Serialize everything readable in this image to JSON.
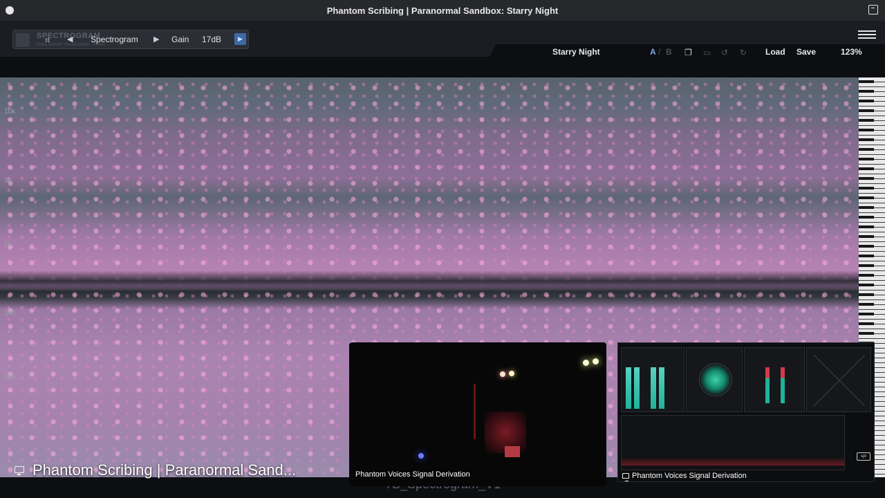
{
  "window": {
    "title": "Phantom Scribing | Paranormal Sandbox: Starry Night"
  },
  "plugin_toolbar": {
    "ghost_title": "SPECTROGRAM",
    "ghost_subtitle": "Data Based Visualization Toolkit",
    "view_name": "Spectrogram",
    "gain_label": "Gain",
    "gain_value": "17dB"
  },
  "right_toolbar": {
    "preset_name": "Starry Night",
    "ab_a": "A",
    "ab_separator": "/",
    "ab_b": "B",
    "load_label": "Load",
    "save_label": "Save",
    "zoom": "123%"
  },
  "spectrogram": {
    "freq_labels": [
      "10k",
      "3k",
      "1k",
      "300",
      "100"
    ],
    "colors": {
      "accent": "#b583b2",
      "background": "#0d0f12"
    }
  },
  "screens": {
    "main_label": "Phantom Scribing | Paranormal Sand...",
    "cam_label": "Phantom Voices Signal Derivation",
    "meters_label": "Phantom Voices Signal Derivation",
    "meters_brand": "spl"
  },
  "bottom_label": "TB_Spectrogram_V1"
}
